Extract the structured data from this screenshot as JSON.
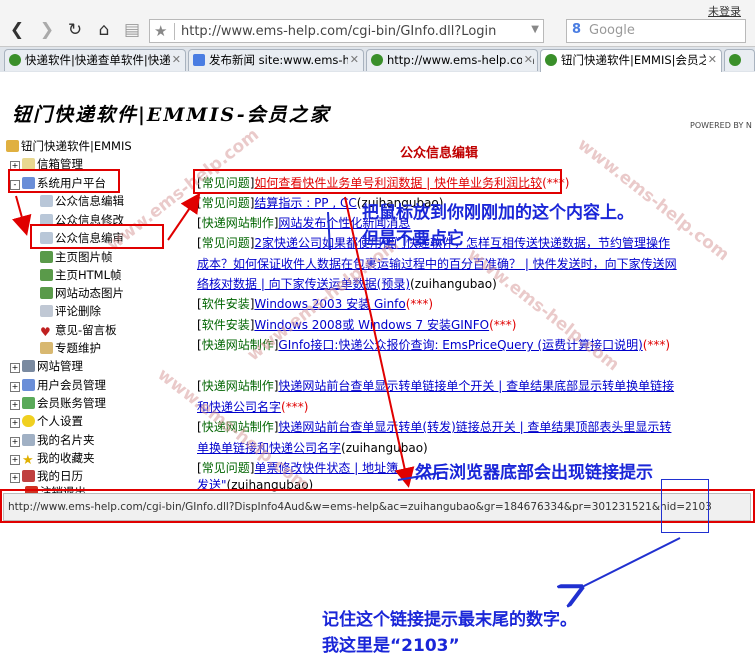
{
  "browser": {
    "login": "未登录",
    "url": "http://www.ems-help.com/cgi-bin/GInfo.dll?Login",
    "search_placeholder": "Google",
    "tabs": [
      {
        "title": "快递软件|快递查单软件|快递",
        "icon_color": "#3a8f2a"
      },
      {
        "title": "发布新闻 site:www.ems-he",
        "icon_color": "#4a7de2"
      },
      {
        "title": "http://www.ems-help.com",
        "icon_color": "#3a8f2a"
      },
      {
        "title": "钮门快递软件|EMMIS|会员之",
        "icon_color": "#3a8f2a"
      },
      {
        "title": "",
        "icon_color": "#3a8f2a"
      }
    ]
  },
  "page": {
    "banner_title": "钮门快递软件|EMMIS-会员之家",
    "powered_by": "POWERED BY N",
    "main_title": "公众信息编辑",
    "watermark": "www.ems-help.com"
  },
  "sidebar": {
    "root": "钮门快递软件|EMMIS",
    "items": [
      {
        "label": "信箱管理",
        "expander": "+",
        "icon": "mailbox-icon"
      },
      {
        "label": "系统用户平台",
        "expander": "-",
        "icon": "user-platform-icon"
      },
      {
        "label": "公众信息编辑",
        "icon": "edit-info-icon"
      },
      {
        "label": "公众信息修改",
        "icon": "modify-info-icon"
      },
      {
        "label": "公众信息编审",
        "icon": "review-info-icon"
      },
      {
        "label": "主页图片帧",
        "icon": "image-frame-icon"
      },
      {
        "label": "主页HTML帧",
        "icon": "html-frame-icon"
      },
      {
        "label": "网站动态图片",
        "icon": "dynamic-image-icon"
      },
      {
        "label": "评论删除",
        "icon": "comment-delete-icon"
      },
      {
        "label": "意见-留言板",
        "icon": "heart-icon"
      },
      {
        "label": "专题维护",
        "icon": "topic-icon"
      },
      {
        "label": "网站管理",
        "expander": "+",
        "icon": "website-icon"
      },
      {
        "label": "用户会员管理",
        "expander": "+",
        "icon": "members-icon"
      },
      {
        "label": "会员账务管理",
        "expander": "+",
        "icon": "accounts-icon"
      },
      {
        "label": "个人设置",
        "expander": "+",
        "icon": "smiley-icon"
      },
      {
        "label": "我的名片夹",
        "expander": "+",
        "icon": "card-icon"
      },
      {
        "label": "我的收藏夹",
        "expander": "+",
        "icon": "star-icon"
      },
      {
        "label": "我的日历",
        "expander": "+",
        "icon": "calendar-icon"
      },
      {
        "label": "注销退出",
        "icon": "logout-icon"
      }
    ]
  },
  "articles": [
    {
      "category": "常见问题",
      "title": "如何查看快件业务单号利润数据 | 快件单业务利润比较",
      "mark": "(***)",
      "author": ""
    },
    {
      "category": "常见问题",
      "title": "结算指示 : PP , CC",
      "mark": "",
      "author": "(zuihangubao)"
    },
    {
      "category": "快递网站制作",
      "title": "网站发布个性化新闻消息",
      "mark": "",
      "author": ""
    },
    {
      "category": "常见问题",
      "title": "2家快递公司如果都使用钮门快递软件，怎样互相传送快递数据，节约管理操作成本？如何保证收件人数据在包裹运输过程中的百分百准确？ | 快件发送时，向下家传送网络核对数据 | 向下家传送运单数据(预录)",
      "mark": "",
      "author": "(zuihangubao)"
    },
    {
      "category": "软件安装",
      "title": "Windows 2003 安装 Ginfo",
      "mark": "(***)",
      "author": ""
    },
    {
      "category": "软件安装",
      "title": "Windows 2008或 Windows 7 安装GINFO",
      "mark": "(***)",
      "author": ""
    },
    {
      "category": "快递网站制作",
      "title": "GInfo接口:快递公众报价查询: EmsPriceQuery (运费计算接口说明)",
      "mark": "(***)",
      "author": ""
    },
    {
      "category": "快递网站制作",
      "title": "快递网站前台查单显示转单链接单个开关 | 查单结果底部显示转单换单链接和快递公司名字",
      "mark": "(***)",
      "author": ""
    },
    {
      "category": "快递网站制作",
      "title": "快递网站前台查单显示转单(转发)链接总开关 | 查单结果顶部表头里显示转单换单链接和快递公司名字",
      "mark": "",
      "author": "(zuihangubao)"
    },
    {
      "category": "常见问题",
      "title": "单票修改快件状态 | 地址簿",
      "mark": "",
      "author": ""
    },
    {
      "category": "",
      "title": "发送\"",
      "mark": "",
      "author": "(zuihangubao)"
    }
  ],
  "statusbar": {
    "url": "http://www.ems-help.com/cgi-bin/GInfo.dll?DispInfo4Aud&w=ems-help&ac=zuihangubao&gr=184676334&pr=301231521&nid=2103"
  },
  "annotations": {
    "hover_hint_1": "把鼠标放到你刚刚加的这个内容上。",
    "hover_hint_2": "但是不要点它",
    "status_hint": "然后浏览器底部会出现链接提示",
    "remember_1": "记住这个链接提示最末尾的数字。",
    "remember_2": "我这里是“2103”"
  }
}
